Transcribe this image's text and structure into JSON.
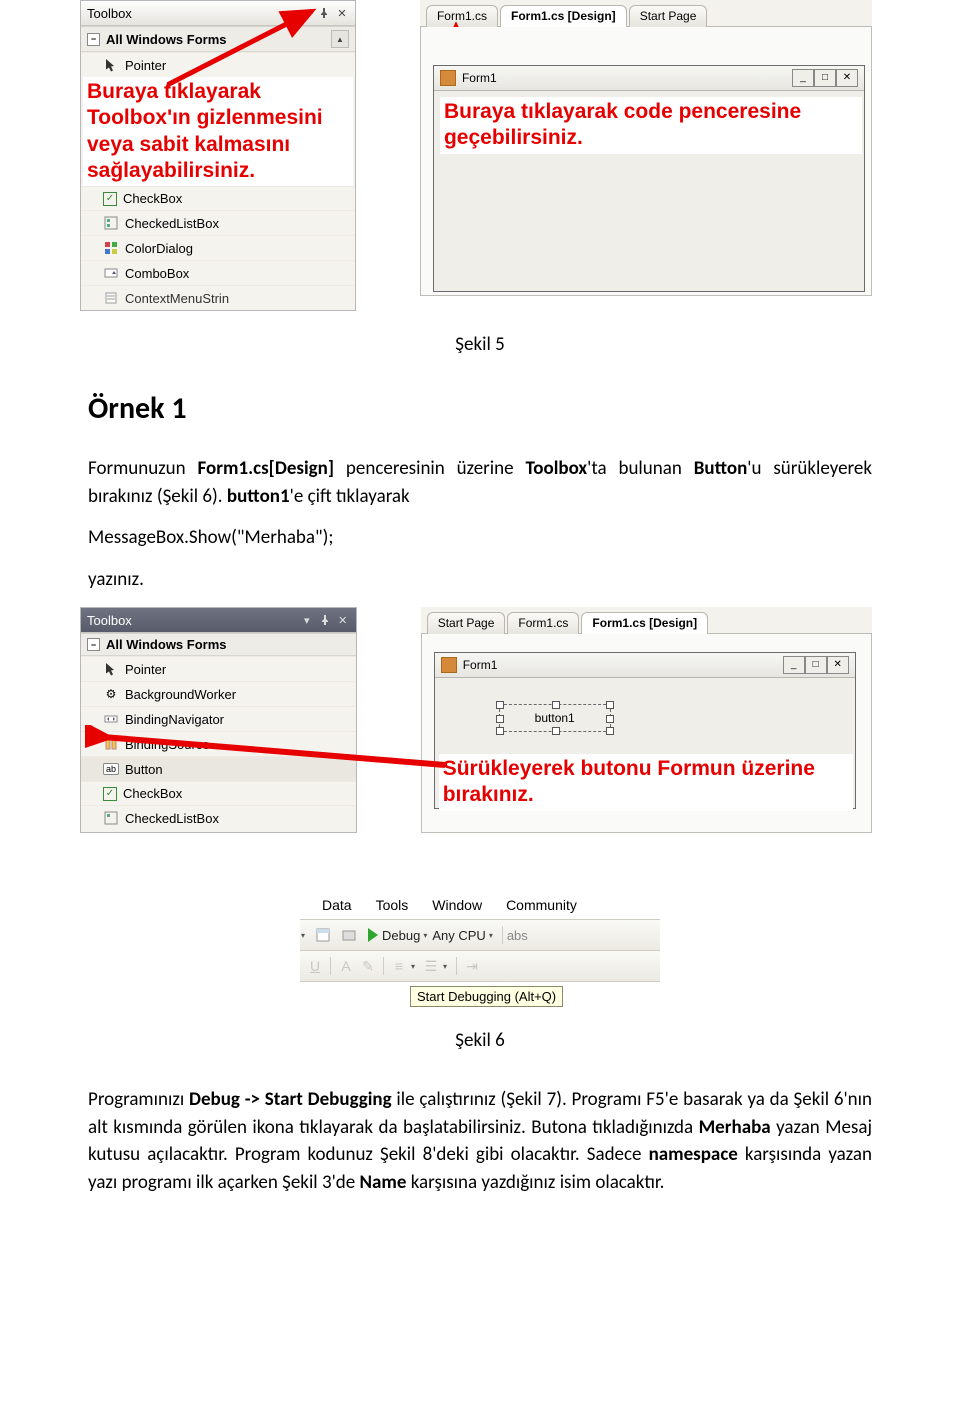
{
  "shot1": {
    "toolbox": {
      "title": "Toolbox",
      "group": "All Windows Forms",
      "items_top": [
        "Pointer"
      ],
      "items_bottom": [
        "CheckBox",
        "CheckedListBox",
        "ColorDialog",
        "ComboBox",
        "ContextMenuStrin"
      ],
      "callout": "Buraya tıklayarak Toolbox'ın gizlenmesini veya sabit kalmasını sağlayabilirsiniz."
    },
    "tabs": {
      "left": "Form1.cs",
      "mid": "Form1.cs [Design]",
      "right": "Start Page"
    },
    "form": {
      "title": "Form1"
    },
    "callout_right": "Buraya tıklayarak code penceresine geçebilirsiniz."
  },
  "caption5": "Şekil 5",
  "heading": "Örnek 1",
  "para1": {
    "pre": "Formunuzun ",
    "b1": "Form1.cs[Design]",
    "mid1": " penceresinin üzerine ",
    "b2": "Toolbox",
    "mid2": "'ta bulunan ",
    "b3": "Button",
    "mid3": "'u sürükleyerek bırakınız (Şekil 6). ",
    "b4": "button1",
    "tail": "'e çift tıklayarak"
  },
  "codeline": "MessageBox.Show(\"Merhaba\");",
  "yaz": "yazınız.",
  "shot2": {
    "toolbox": {
      "title": "Toolbox",
      "group": "All Windows Forms",
      "items": [
        "Pointer",
        "BackgroundWorker",
        "BindingNavigator",
        "BindingSource",
        "Button",
        "CheckBox",
        "CheckedListBox"
      ]
    },
    "tabs": {
      "left": "Start Page",
      "mid": "Form1.cs",
      "right": "Form1.cs [Design]"
    },
    "form": {
      "title": "Form1",
      "button": "button1"
    },
    "callout": "Sürükleyerek butonu Formun üzerine bırakınız."
  },
  "shot3": {
    "menus": [
      "Data",
      "Tools",
      "Window",
      "Community"
    ],
    "debug": "Debug",
    "anycpu": "Any CPU",
    "abs": "abs",
    "tooltip": "Start Debugging (Alt+Q)"
  },
  "caption6": "Şekil 6",
  "para2": {
    "pre": "Programınızı ",
    "b1": "Debug -> Start Debugging",
    "mid1": " ile çalıştırınız (Şekil 7). Programı F5'e basarak ya da Şekil 6'nın alt kısmında görülen ikona tıklayarak da başlatabilirsiniz. Butona tıkladığınızda ",
    "b2": "Merhaba",
    "mid2": " yazan Mesaj kutusu açılacaktır. Program kodunuz Şekil 8'deki gibi olacaktır. Sadece ",
    "b3": "namespace",
    "mid3": " karşısında yazan yazı programı ilk açarken Şekil 3'de ",
    "b4": "Name",
    "tail": " karşısına yazdığınız isim olacaktır."
  }
}
